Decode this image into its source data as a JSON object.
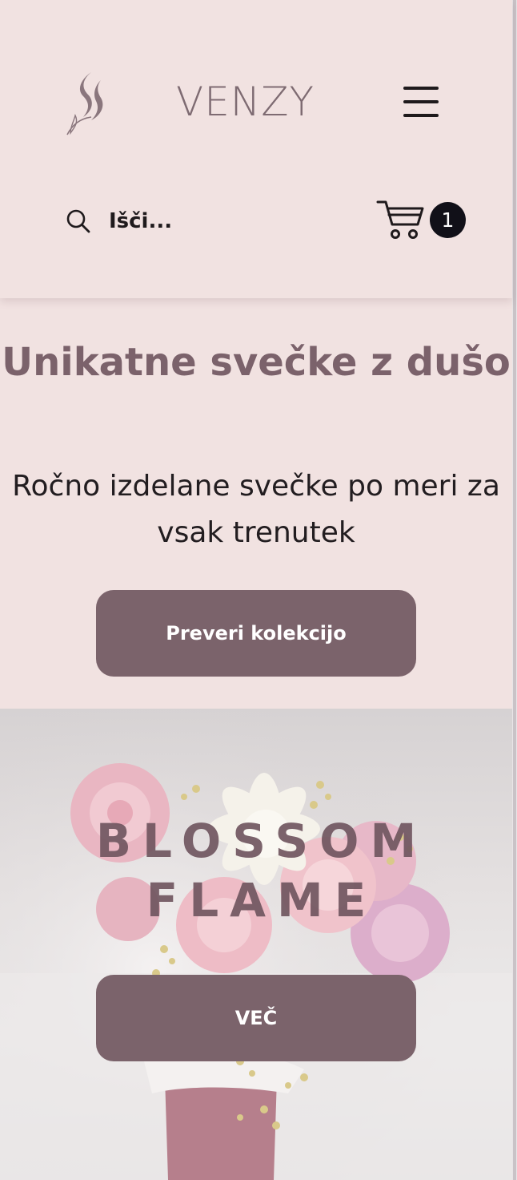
{
  "header": {
    "brand": "VENZY",
    "search_label": "Išči...",
    "cart_count": "1"
  },
  "hero": {
    "title": "Unikatne svečke z dušo",
    "subtitle": "Ročno izdelane svečke po meri za vsak trenutek",
    "cta_label": "Preveri kolekcijo"
  },
  "banner": {
    "title": "BLOSSOM FLAME",
    "cta_label": "VEČ"
  },
  "icons": {
    "logo": "flame-swirl-logo-icon",
    "menu": "hamburger-menu-icon",
    "search": "search-icon",
    "cart": "cart-icon"
  },
  "colors": {
    "background": "#f1e2e1",
    "accent": "#7b636b",
    "brand_text": "#7e6b72",
    "dark": "#1f1a1c"
  }
}
